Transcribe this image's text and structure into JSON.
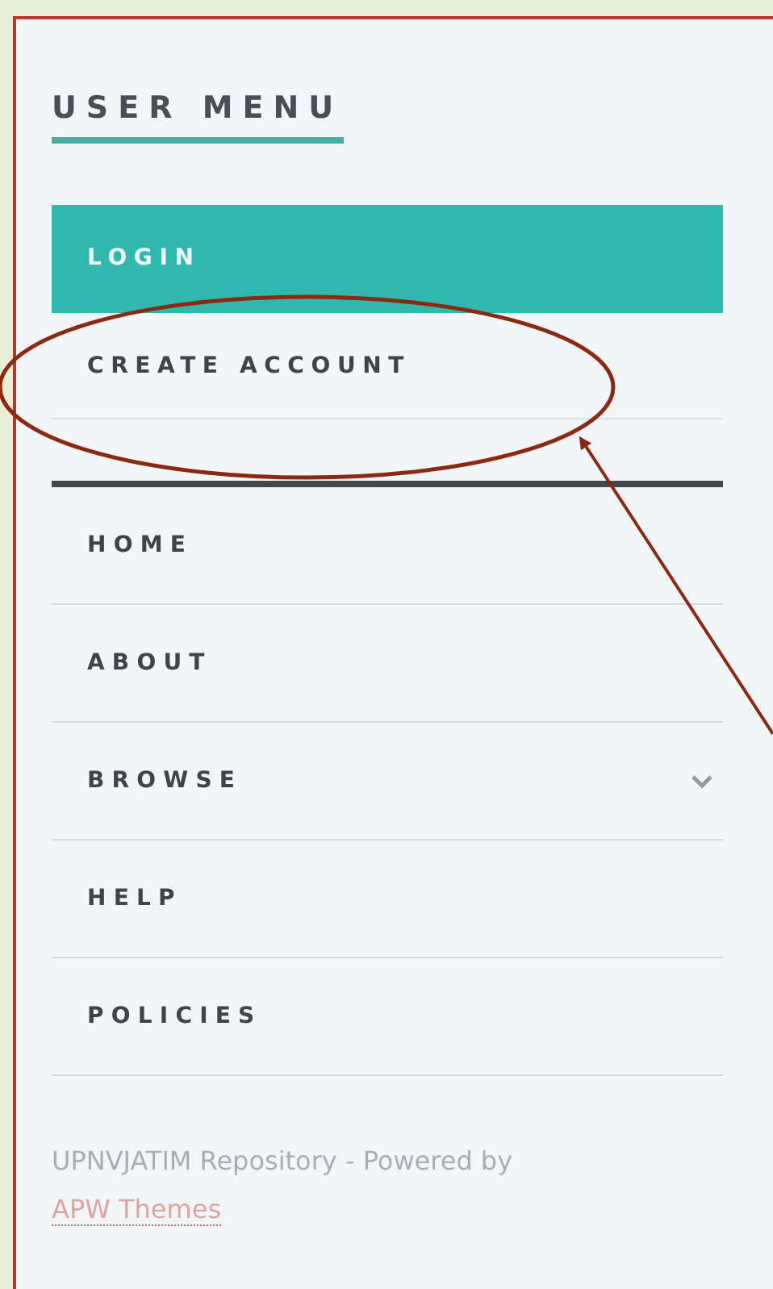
{
  "user_menu": {
    "title": "USER MENU",
    "items": [
      {
        "label": "LOGIN",
        "selected": true
      },
      {
        "label": "CREATE ACCOUNT",
        "selected": false
      }
    ]
  },
  "nav": {
    "items": [
      {
        "label": "HOME",
        "has_submenu": false
      },
      {
        "label": "ABOUT",
        "has_submenu": false
      },
      {
        "label": "BROWSE",
        "has_submenu": true
      },
      {
        "label": "HELP",
        "has_submenu": false
      },
      {
        "label": "POLICIES",
        "has_submenu": false
      }
    ]
  },
  "footer": {
    "text": "UPNVJATIM Repository - Powered by",
    "link": "APW Themes"
  }
}
